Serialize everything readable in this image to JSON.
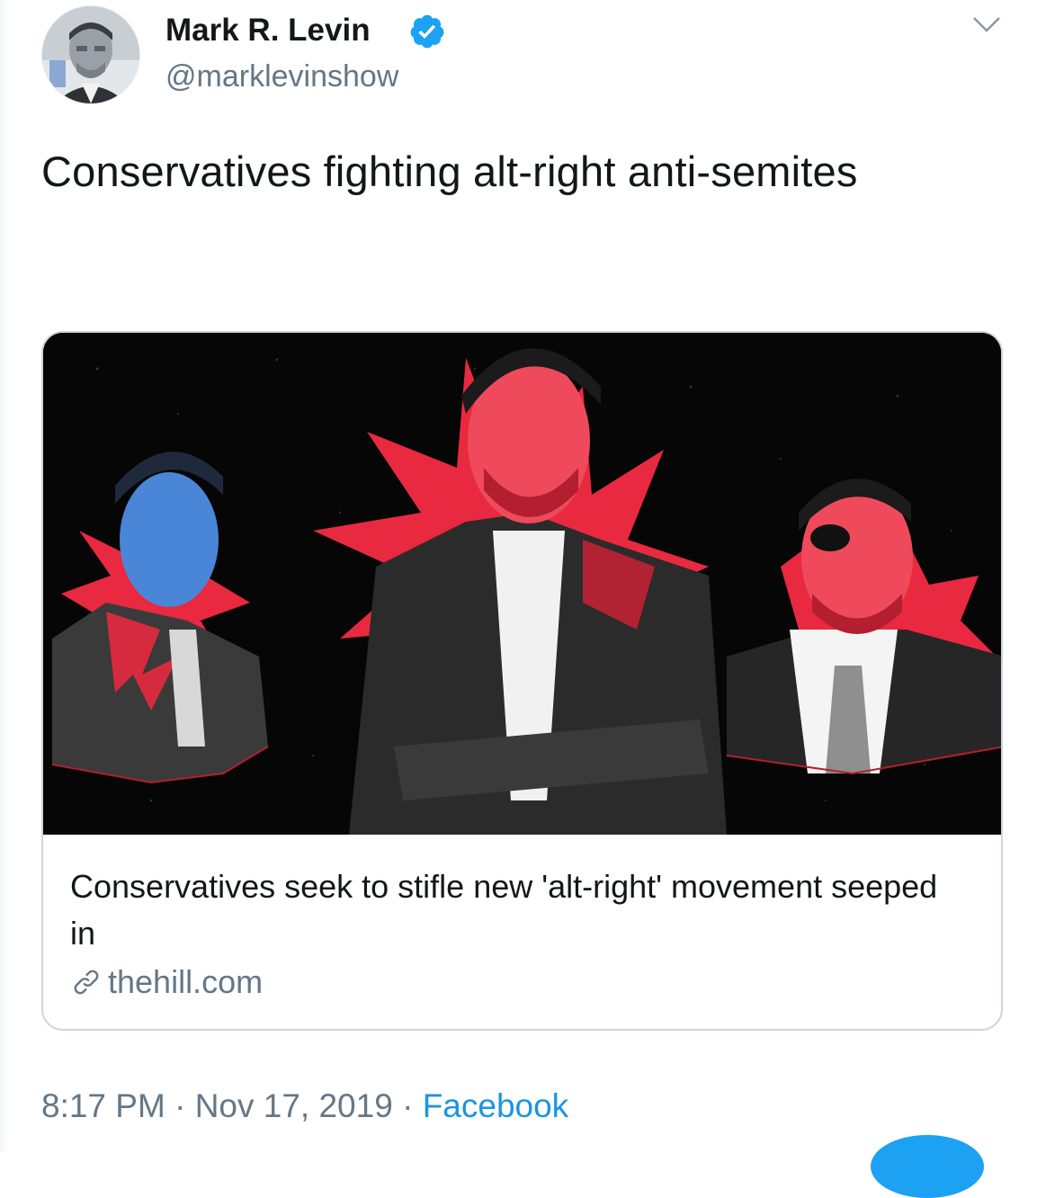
{
  "author": {
    "display_name": "Mark R. Levin",
    "handle": "@marklevinshow",
    "verified": true
  },
  "tweet": {
    "text": "Conservatives fighting alt-right anti-semites"
  },
  "card": {
    "title": "Conservatives seek to stifle new 'alt-right' movement seeped in",
    "domain": "thehill.com"
  },
  "meta": {
    "time": "8:17 PM",
    "separator1": " · ",
    "date": "Nov 17, 2019",
    "separator2": " · ",
    "source": "Facebook"
  },
  "colors": {
    "accent": "#1da1f2",
    "secondary_text": "#657786",
    "card_red": "#e8293f",
    "card_blue": "#4a86d8"
  },
  "icons": {
    "verified": "verified-badge-icon",
    "menu": "chevron-down-icon",
    "link": "link-icon"
  }
}
